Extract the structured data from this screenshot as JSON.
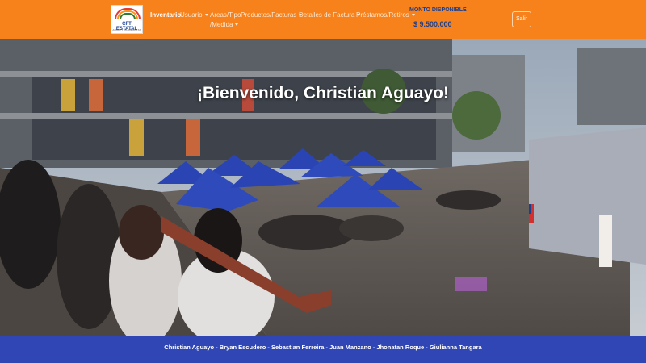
{
  "header": {
    "logo_name": "CFT ESTATAL",
    "logo_subtitle": "ARICA Y PARINACOTA",
    "nav": [
      {
        "label": "Inventario",
        "active": true,
        "dropdown": false
      },
      {
        "label": "Usuario",
        "dropdown": true
      },
      {
        "label": "Areas/Tipo",
        "dropdown": false
      },
      {
        "label": "/Medida",
        "dropdown": true
      },
      {
        "label": "Productos/Facturas",
        "dropdown": true
      },
      {
        "label": "Detalles de Factura",
        "dropdown": true
      },
      {
        "label": "Préstamos/Retiros",
        "dropdown": true
      }
    ],
    "monto_label": "MONTO DISPONIBLE",
    "monto_value": "$ 9.500.000",
    "logout_label": "Salir"
  },
  "hero": {
    "welcome": "¡Bienvenido, Christian Aguayo!"
  },
  "footer": {
    "credits": "Christian Aguayo - Bryan Escudero - Sebastian Ferreira - Juan Manzano - Jhonatan Roque - Giulianna Tangara"
  },
  "colors": {
    "navbar": "#f7811b",
    "footer": "#2f46b4",
    "accent_text": "#1a3f8f",
    "tent": "#2a45b3"
  },
  "icons": [
    "caret-down-icon",
    "chile-flag-icon"
  ]
}
